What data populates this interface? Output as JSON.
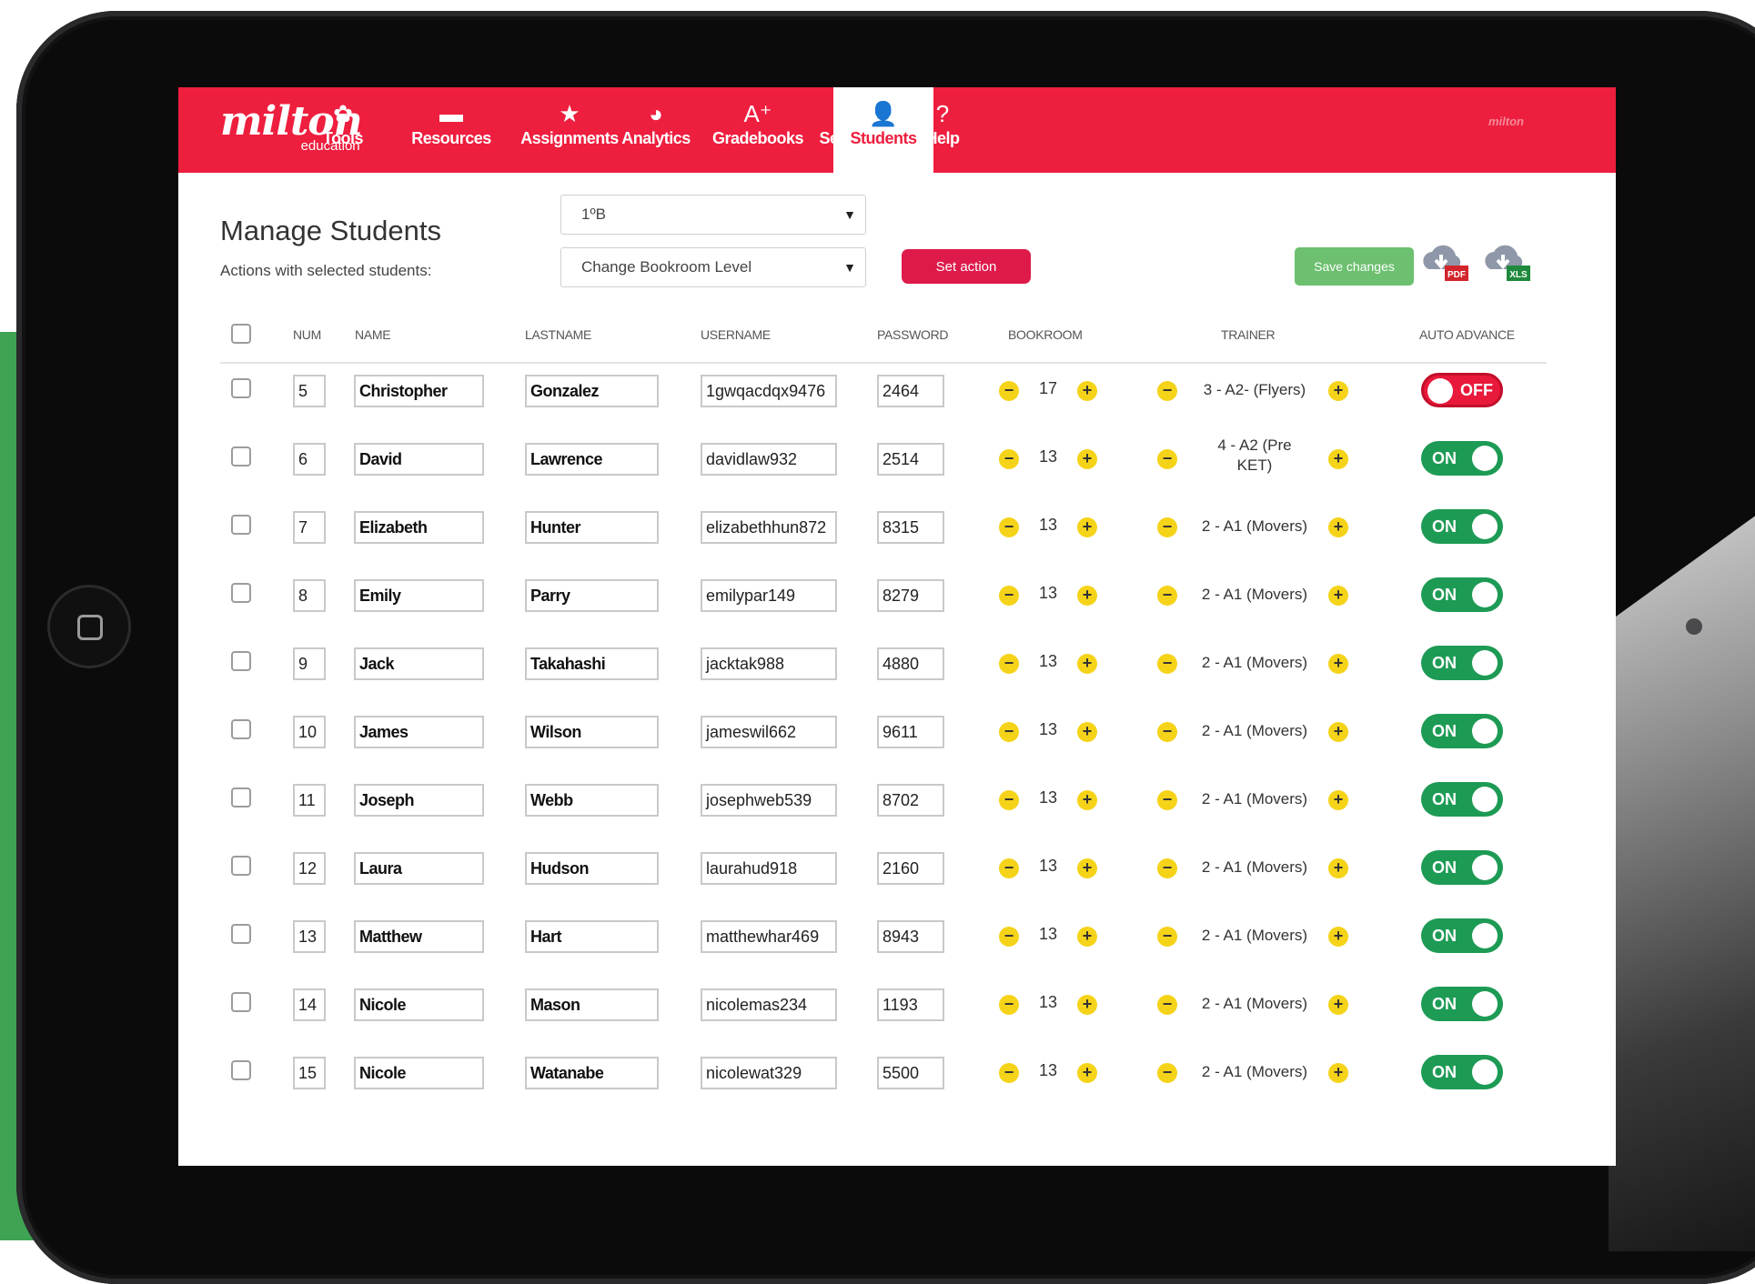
{
  "brand": {
    "name": "milton",
    "sub": "education"
  },
  "nav": [
    {
      "label": "Tools",
      "icon": "gear-icon",
      "glyph": "✿"
    },
    {
      "label": "Resources",
      "icon": "folder-icon",
      "glyph": "▬"
    },
    {
      "label": "Assignments",
      "icon": "star-icon",
      "glyph": "★"
    },
    {
      "label": "Analytics",
      "icon": "pie-chart-icon",
      "glyph": "◕"
    },
    {
      "label": "Gradebooks",
      "icon": "grade-icon",
      "glyph": "A⁺"
    },
    {
      "label": "Sections",
      "icon": "presentation-icon",
      "glyph": "▤"
    },
    {
      "label": "Students",
      "icon": "user-icon",
      "glyph": "👤",
      "active": true
    },
    {
      "label": "Help",
      "icon": "help-icon",
      "glyph": "?"
    }
  ],
  "page": {
    "title": "Manage Students",
    "actions_label": "Actions with selected students:",
    "class_select": "1ºB",
    "action_select": "Change Bookroom Level",
    "set_action": "Set action",
    "save_changes": "Save changes",
    "pdf": "PDF",
    "xls": "XLS"
  },
  "columns": [
    "NUM",
    "NAME",
    "LASTNAME",
    "USERNAME",
    "PASSWORD",
    "BOOKROOM",
    "TRAINER",
    "AUTO ADVANCE"
  ],
  "students": [
    {
      "num": "5",
      "name": "Christopher",
      "lastname": "Gonzalez",
      "username": "1gwqacdqx9476",
      "password": "2464",
      "bookroom": "17",
      "trainer": "3 - A2- (Flyers)",
      "auto": "OFF"
    },
    {
      "num": "6",
      "name": "David",
      "lastname": "Lawrence",
      "username": "davidlaw932",
      "password": "2514",
      "bookroom": "13",
      "trainer": "4 - A2 (Pre KET)",
      "auto": "ON"
    },
    {
      "num": "7",
      "name": "Elizabeth",
      "lastname": "Hunter",
      "username": "elizabethhun872",
      "password": "8315",
      "bookroom": "13",
      "trainer": "2 - A1 (Movers)",
      "auto": "ON"
    },
    {
      "num": "8",
      "name": "Emily",
      "lastname": "Parry",
      "username": "emilypar149",
      "password": "8279",
      "bookroom": "13",
      "trainer": "2 - A1 (Movers)",
      "auto": "ON"
    },
    {
      "num": "9",
      "name": "Jack",
      "lastname": "Takahashi",
      "username": "jacktak988",
      "password": "4880",
      "bookroom": "13",
      "trainer": "2 - A1 (Movers)",
      "auto": "ON"
    },
    {
      "num": "10",
      "name": "James",
      "lastname": "Wilson",
      "username": "jameswil662",
      "password": "9611",
      "bookroom": "13",
      "trainer": "2 - A1 (Movers)",
      "auto": "ON"
    },
    {
      "num": "11",
      "name": "Joseph",
      "lastname": "Webb",
      "username": "josephweb539",
      "password": "8702",
      "bookroom": "13",
      "trainer": "2 - A1 (Movers)",
      "auto": "ON"
    },
    {
      "num": "12",
      "name": "Laura",
      "lastname": "Hudson",
      "username": "laurahud918",
      "password": "2160",
      "bookroom": "13",
      "trainer": "2 - A1 (Movers)",
      "auto": "ON"
    },
    {
      "num": "13",
      "name": "Matthew",
      "lastname": "Hart",
      "username": "matthewhar469",
      "password": "8943",
      "bookroom": "13",
      "trainer": "2 - A1 (Movers)",
      "auto": "ON"
    },
    {
      "num": "14",
      "name": "Nicole",
      "lastname": "Mason",
      "username": "nicolemas234",
      "password": "1193",
      "bookroom": "13",
      "trainer": "2 - A1 (Movers)",
      "auto": "ON"
    },
    {
      "num": "15",
      "name": "Nicole",
      "lastname": "Watanabe",
      "username": "nicolewat329",
      "password": "5500",
      "bookroom": "13",
      "trainer": "2 - A1 (Movers)",
      "auto": "ON"
    }
  ],
  "colors": {
    "brand_red": "#ee1e3e",
    "toggle_on": "#1d9b55",
    "toggle_off": "#e8193a",
    "save_green": "#6cc06f",
    "stepper_yellow": "#f5d319"
  }
}
